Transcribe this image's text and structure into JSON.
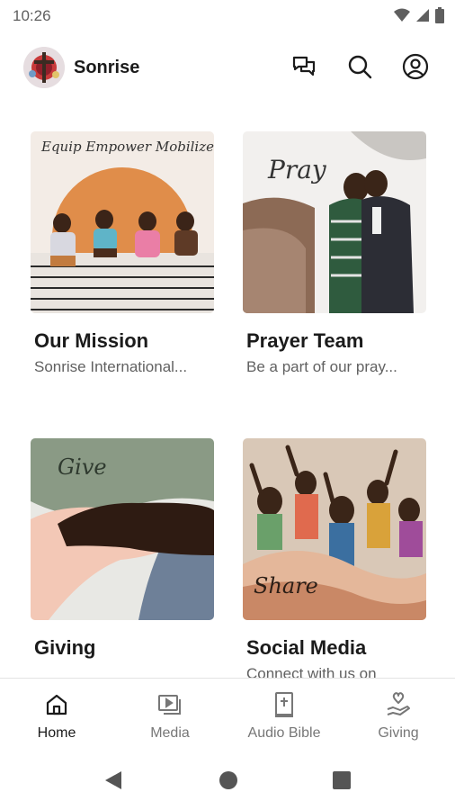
{
  "status_bar": {
    "time": "10:26"
  },
  "app_bar": {
    "title": "Sonrise"
  },
  "cards": [
    {
      "title": "Our Mission",
      "subtitle": "Sonrise International...",
      "image_text": "Equip Empower Mobilize"
    },
    {
      "title": "Prayer Team",
      "subtitle": "Be a part of our pray...",
      "image_text": "Pray"
    },
    {
      "title": "Giving",
      "subtitle": "",
      "image_text": "Give"
    },
    {
      "title": "Social Media",
      "subtitle": "Connect with us on",
      "image_text": "Share"
    }
  ],
  "bottom_nav": [
    {
      "label": "Home",
      "icon": "home-icon",
      "active": true
    },
    {
      "label": "Media",
      "icon": "media-icon",
      "active": false
    },
    {
      "label": "Audio Bible",
      "icon": "bible-icon",
      "active": false
    },
    {
      "label": "Giving",
      "icon": "giving-icon",
      "active": false
    }
  ],
  "colors": {
    "accent": "#1b1b1b",
    "inactive": "#777777"
  }
}
